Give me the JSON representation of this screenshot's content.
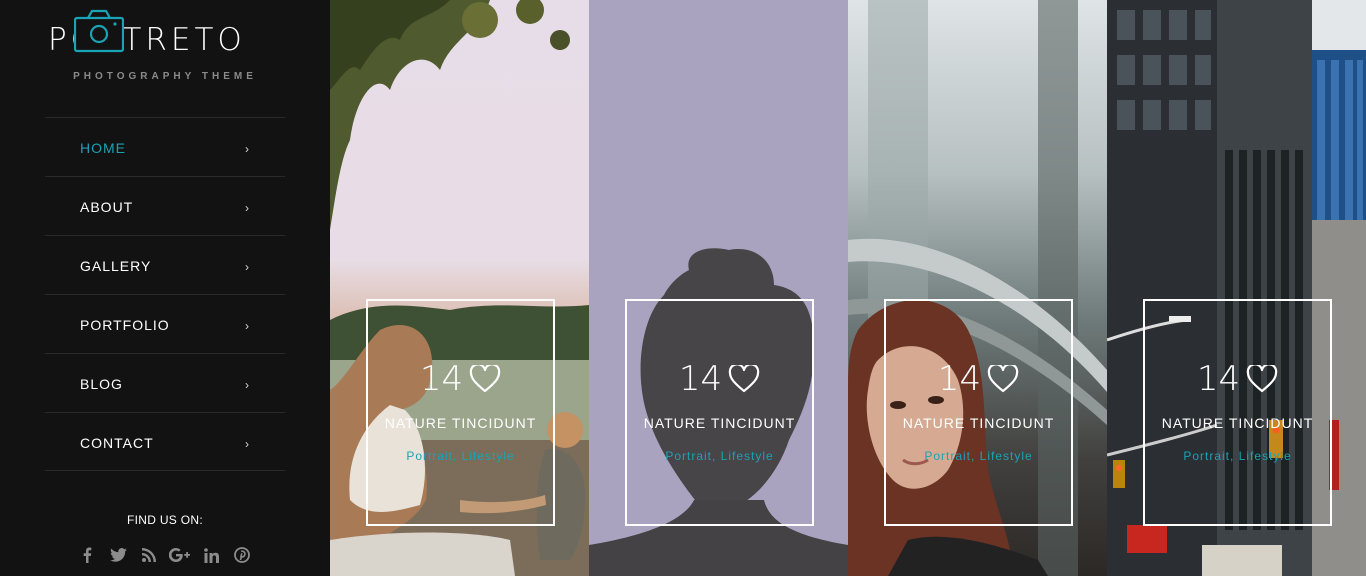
{
  "theme": {
    "accent": "#1aa3b5"
  },
  "brand": {
    "logo_text": "PORTRETO",
    "tagline": "PHOTOGRAPHY THEME"
  },
  "nav": {
    "items": [
      {
        "label": "HOME",
        "chevron": "›"
      },
      {
        "label": "ABOUT",
        "chevron": "›"
      },
      {
        "label": "GALLERY",
        "chevron": "›"
      },
      {
        "label": "PORTFOLIO",
        "chevron": "›"
      },
      {
        "label": "BLOG",
        "chevron": "›"
      },
      {
        "label": "CONTACT",
        "chevron": "›"
      }
    ],
    "active_index": 0
  },
  "social": {
    "label": "FIND US ON:",
    "icons": [
      {
        "name": "facebook-icon",
        "glyph": "f"
      },
      {
        "name": "twitter-icon",
        "glyph": "t"
      },
      {
        "name": "rss-icon",
        "glyph": ""
      },
      {
        "name": "google-plus-icon",
        "glyph": "G+"
      },
      {
        "name": "linkedin-icon",
        "glyph": "in"
      },
      {
        "name": "pinterest-icon",
        "glyph": "p"
      }
    ]
  },
  "gallery": {
    "panels": [
      {
        "photo": "mother-and-child-by-lake",
        "likes": "14",
        "title": "NATURE TINCIDUNT",
        "tags": "Portrait, Lifestyle"
      },
      {
        "photo": "silhouette-portrait",
        "likes": "14",
        "title": "NATURE TINCIDUNT",
        "tags": "Portrait, Lifestyle"
      },
      {
        "photo": "woman-looking-up",
        "likes": "14",
        "title": "NATURE TINCIDUNT",
        "tags": "Portrait, Lifestyle"
      },
      {
        "photo": "city-street-buildings",
        "likes": "14",
        "title": "NATURE TINCIDUNT",
        "tags": "Portrait, Lifestyle"
      }
    ]
  }
}
